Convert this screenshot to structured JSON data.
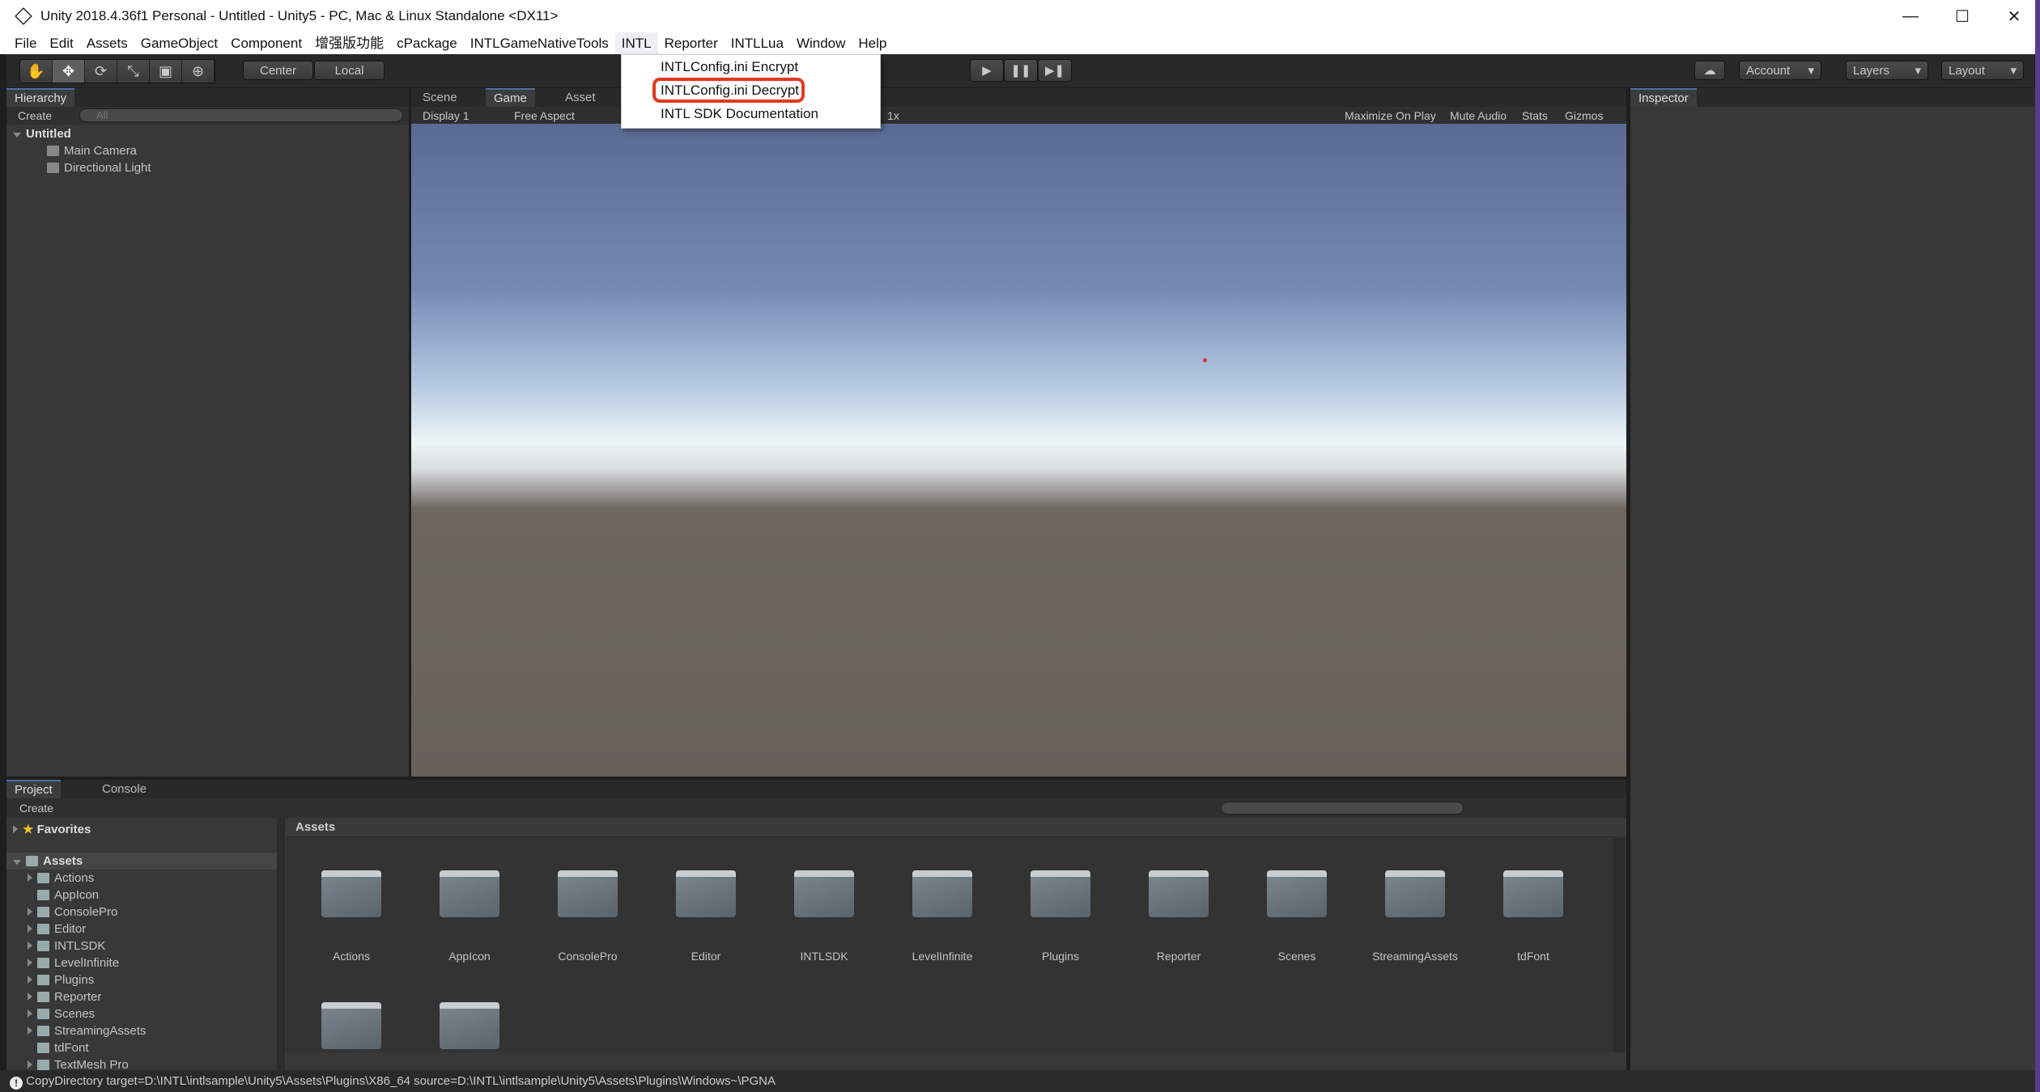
{
  "window": {
    "title": "Unity 2018.4.36f1 Personal - Untitled - Unity5 - PC, Mac & Linux Standalone <DX11>",
    "minimize": "—",
    "maximize": "☐",
    "close": "✕"
  },
  "menubar": [
    "File",
    "Edit",
    "Assets",
    "GameObject",
    "Component",
    "增强版功能",
    "cPackage",
    "INTLGameNativeTools",
    "INTL",
    "Reporter",
    "INTLLua",
    "Window",
    "Help"
  ],
  "intl_menu": {
    "items": [
      "INTLConfig.ini Encrypt",
      "INTLConfig.ini Decrypt",
      "INTL SDK Documentation"
    ],
    "highlighted": "INTLConfig.ini Decrypt",
    "highlight_color": "#e03a1e"
  },
  "toolbar": {
    "tools": [
      "✋",
      "✥",
      "⟳",
      "⤡",
      "▣",
      "⊕"
    ],
    "pivot": "Center",
    "space": "Local",
    "play": "▶",
    "pause": "❚❚",
    "step": "▶❚",
    "cloud": "☁",
    "account": "Account",
    "layers": "Layers",
    "layout": "Layout",
    "caret": "▾"
  },
  "hierarchy": {
    "tab": "Hierarchy",
    "create": "Create",
    "search_placeholder": "All",
    "scene": "Untitled",
    "objects": [
      "Main Camera",
      "Directional Light"
    ]
  },
  "center": {
    "tabs": [
      "Scene",
      "Game",
      "Asset"
    ],
    "display": "Display 1",
    "aspect": "Free Aspect",
    "scale": "1x",
    "options": [
      "Maximize On Play",
      "Mute Audio",
      "Stats",
      "Gizmos"
    ]
  },
  "inspector": {
    "tab": "Inspector"
  },
  "project": {
    "tabs": [
      "Project",
      "Console"
    ],
    "create": "Create",
    "favorites": "Favorites",
    "root": "Assets",
    "tree": [
      "Actions",
      "AppIcon",
      "ConsolePro",
      "Editor",
      "INTLSDK",
      "LevelInfinite",
      "Plugins",
      "Reporter",
      "Scenes",
      "StreamingAssets",
      "tdFont",
      "TextMesh Pro"
    ],
    "breadcrumb": "Assets",
    "grid": [
      "Actions",
      "AppIcon",
      "ConsolePro",
      "Editor",
      "INTLSDK",
      "LevelInfinite",
      "Plugins",
      "Reporter",
      "Scenes",
      "StreamingAssets",
      "tdFont",
      "",
      ""
    ]
  },
  "status": {
    "message": "CopyDirectory target=D:\\INTL\\intlsample\\Unity5\\Assets\\Plugins\\X86_64 source=D:\\INTL\\intlsample\\Unity5\\Assets\\Plugins\\Windows~\\PGNA"
  }
}
